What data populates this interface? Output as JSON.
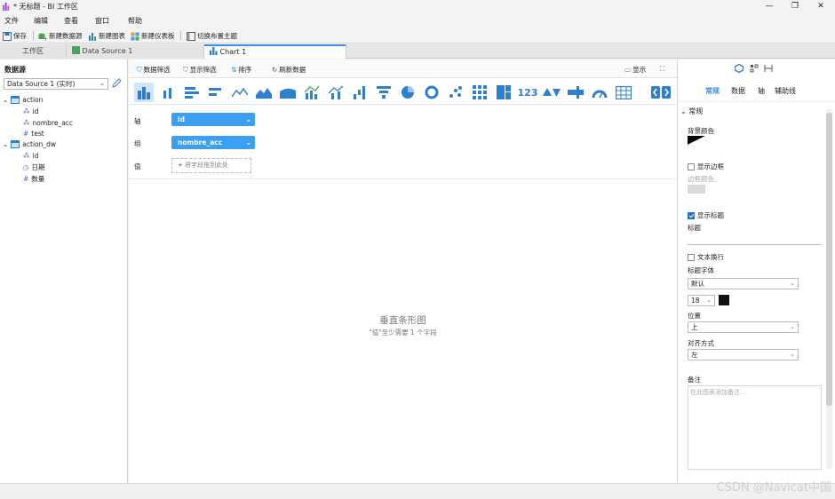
{
  "window": {
    "title": "* 无标题 - BI 工作区",
    "minimize": "—",
    "maximize": "❐",
    "close": "✕"
  },
  "menu": [
    "文件",
    "编辑",
    "查看",
    "窗口",
    "帮助"
  ],
  "toolbar": {
    "save": "保存",
    "new_datasource": "新建数据源",
    "new_chart": "新建图表",
    "new_dashboard": "新建仪表板",
    "switch_theme": "切换布置主题"
  },
  "tabs": [
    {
      "label": "工作区"
    },
    {
      "label": "Data Source 1"
    },
    {
      "label": "Chart 1"
    }
  ],
  "left": {
    "header": "数据源",
    "datasource": "Data Source 1 (实时)",
    "tree": [
      {
        "label": "action",
        "children": [
          "id",
          "nombre_acc",
          "test"
        ]
      },
      {
        "label": "action_dw",
        "children": [
          "id",
          "日期",
          "数量"
        ]
      }
    ]
  },
  "center_toolbar": {
    "data_filter": "数据筛选",
    "show_filter": "显示筛选",
    "sort": "排序",
    "refresh": "刷新数据",
    "display": "显示"
  },
  "chart_types_extra": {
    "number": "123"
  },
  "fields": {
    "axis_label": "轴",
    "axis_value": "id",
    "group_label": "组",
    "group_value": "nombre_acc",
    "value_label": "值",
    "value_drop": "将字段拖到此处"
  },
  "placeholder": {
    "title": "垂直条形图",
    "subtitle": "\"值\"至少需要 1 个字段"
  },
  "right": {
    "tabs": [
      "常规",
      "数据",
      "轴",
      "辅助线"
    ],
    "section": "常规",
    "bg_color_label": "背景颜色",
    "show_border": "显示边框",
    "border_color_label": "边框颜色",
    "show_title": "显示标题",
    "title_label": "标题",
    "title_value": "",
    "wrap_text": "文本换行",
    "title_font_label": "标题字体",
    "title_font_value": "默认",
    "font_size": "18",
    "position_label": "位置",
    "position_value": "上",
    "align_label": "对齐方式",
    "align_value": "左",
    "notes_label": "备注",
    "notes_placeholder": "在此图表添加备注..."
  },
  "colors": {
    "accent": "#3b9ff3",
    "selected_tab": "#3a8ee6",
    "font_color": "#111111"
  },
  "watermark": "CSDN @Navicat中国"
}
